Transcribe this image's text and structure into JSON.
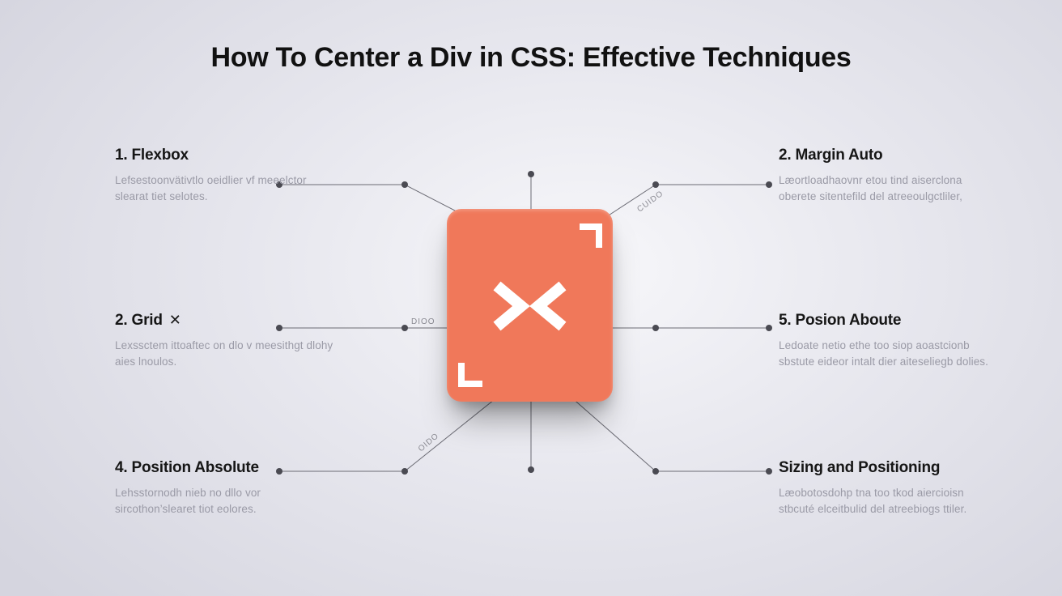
{
  "title": "How To Center a Div in CSS: Effective Techniques",
  "items": {
    "flexbox": {
      "heading": "1.  Flexbox",
      "desc": "Lefsestoonvätivtlo oeidlier vf meeelctor slearat tiet selotes."
    },
    "grid": {
      "heading": "2. Grid",
      "desc": "Lexssctem ittoaftec on dlo v meesithgt dlohy aies lnoulos."
    },
    "pos_abs": {
      "heading": "4.  Position Absolute",
      "desc": "Lehsstornodh nieb no dllo vor sircothon’slearet tiot eolores."
    },
    "margin": {
      "heading": "2. Margin Auto",
      "desc": "Læortloadhaovnr etou tind aiserclona oberete sitentefild del atreeoulgctliler,"
    },
    "posion": {
      "heading": "5.  Posion Aboute",
      "desc": "Ledoate netio ethe too siop aoastcionb sbstute eideor intalt dier aiteseliegb dolies."
    },
    "sizing": {
      "heading": "Sizing and Positioning",
      "desc": "Læobotosdohp tna too tkod aiercioisn stbcuté elceitbulid del atreebiogs ttiler."
    }
  },
  "labels": {
    "curdo": "CUIDO",
    "oido": "OIDO",
    "dioo": "DIOO"
  },
  "colors": {
    "accent": "#f0785a",
    "text": "#161616",
    "muted": "#9a9aa6",
    "line": "#6b6b74"
  }
}
